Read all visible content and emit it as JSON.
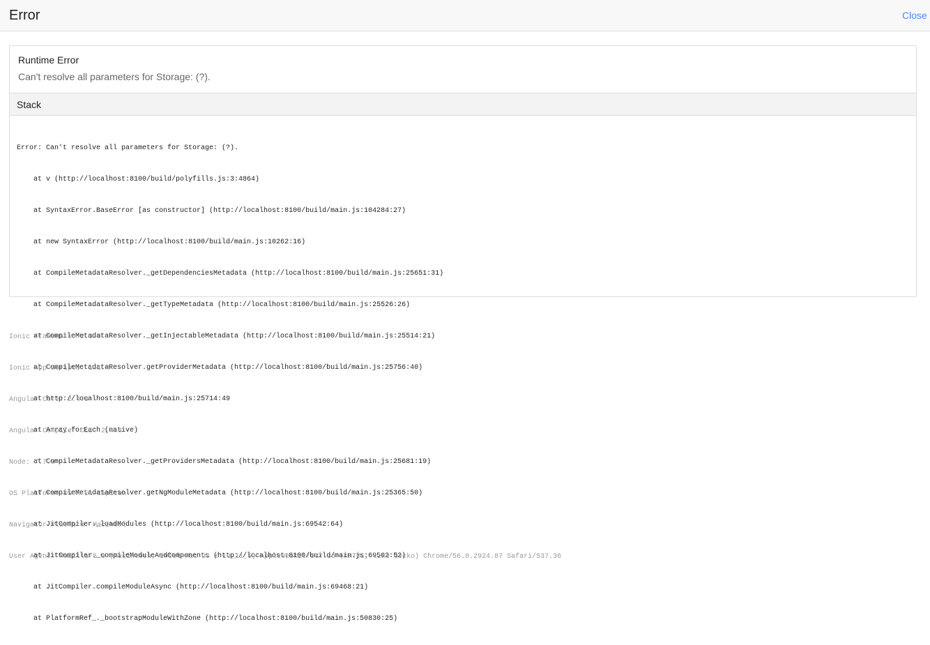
{
  "toolbar": {
    "title": "Error",
    "close_label": "Close"
  },
  "error": {
    "title": "Runtime Error",
    "message": "Can't resolve all parameters for Storage: (?)."
  },
  "stack": {
    "title": "Stack",
    "lines": [
      "Error: Can't resolve all parameters for Storage: (?).",
      "    at v (http://localhost:8100/build/polyfills.js:3:4864)",
      "    at SyntaxError.BaseError [as constructor] (http://localhost:8100/build/main.js:104284:27)",
      "    at new SyntaxError (http://localhost:8100/build/main.js:10262:16)",
      "    at CompileMetadataResolver._getDependenciesMetadata (http://localhost:8100/build/main.js:25651:31)",
      "    at CompileMetadataResolver._getTypeMetadata (http://localhost:8100/build/main.js:25526:26)",
      "    at CompileMetadataResolver._getInjectableMetadata (http://localhost:8100/build/main.js:25514:21)",
      "    at CompileMetadataResolver.getProviderMetadata (http://localhost:8100/build/main.js:25756:40)",
      "    at http://localhost:8100/build/main.js:25714:49",
      "    at Array.forEach (native)",
      "    at CompileMetadataResolver._getProvidersMetadata (http://localhost:8100/build/main.js:25681:19)",
      "    at CompileMetadataResolver.getNgModuleMetadata (http://localhost:8100/build/main.js:25365:50)",
      "    at JitCompiler._loadModules (http://localhost:8100/build/main.js:69542:64)",
      "    at JitCompiler._compileModuleAndComponents (http://localhost:8100/build/main.js:69502:52)",
      "    at JitCompiler.compileModuleAsync (http://localhost:8100/build/main.js:69468:21)",
      "    at PlatformRef_._bootstrapModuleWithZone (http://localhost:8100/build/main.js:50830:25)"
    ]
  },
  "env_info": {
    "lines": [
      "Ionic Framework: 2.3.0",
      "Ionic App Scripts: 1.1.4",
      "Angular Core: 2.4.8",
      "Angular Compiler CLI: 2.4.8",
      "Node: 7.7.0",
      "OS Platform: OS X El Capitan",
      "Navigator Platform: MacIntel",
      "User Agent: Mozilla/5.0 (Macintosh; Intel Mac OS X 10_11_5) AppleWebKit/537.36 (KHTML, like Gecko) Chrome/56.0.2924.87 Safari/537.36"
    ]
  }
}
